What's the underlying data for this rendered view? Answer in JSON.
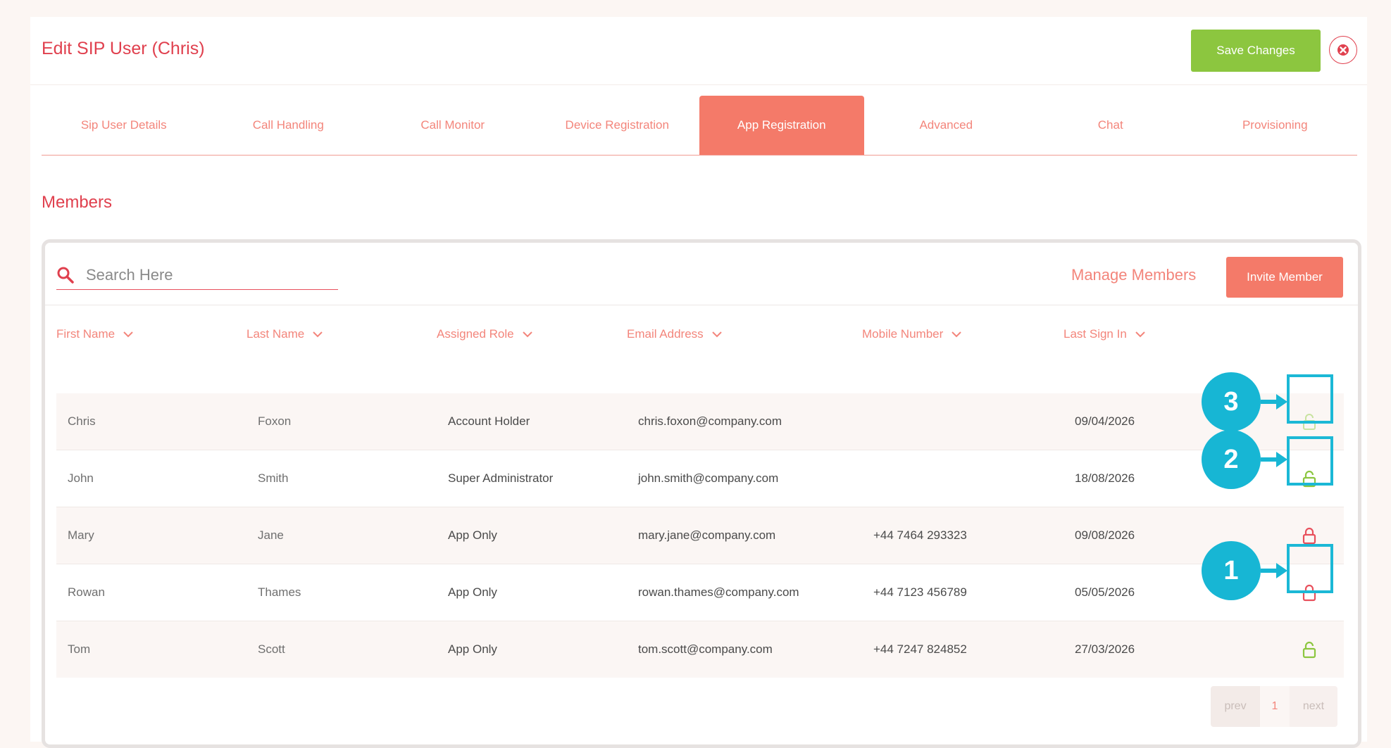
{
  "header": {
    "title": "Edit SIP User (Chris)",
    "save_label": "Save Changes"
  },
  "tabs": [
    {
      "label": "Sip User Details",
      "active": false
    },
    {
      "label": "Call Handling",
      "active": false
    },
    {
      "label": "Call Monitor",
      "active": false
    },
    {
      "label": "Device Registration",
      "active": false
    },
    {
      "label": "App Registration",
      "active": true
    },
    {
      "label": "Advanced",
      "active": false
    },
    {
      "label": "Chat",
      "active": false
    },
    {
      "label": "Provisioning",
      "active": false
    }
  ],
  "members": {
    "section_title": "Members",
    "search_placeholder": "Search Here",
    "manage_label": "Manage Members",
    "invite_label": "Invite Member",
    "columns": [
      "First Name",
      "Last Name",
      "Assigned Role",
      "Email Address",
      "Mobile Number",
      "Last Sign In"
    ],
    "rows": [
      {
        "first": "Chris",
        "last": "Foxon",
        "role": "Account Holder",
        "email": "chris.foxon@company.com",
        "mobile": "",
        "last_sign_in": "09/04/2026",
        "lock": "unlocked-disabled"
      },
      {
        "first": "John",
        "last": "Smith",
        "role": "Super Administrator",
        "email": "john.smith@company.com",
        "mobile": "",
        "last_sign_in": "18/08/2026",
        "lock": "unlocked"
      },
      {
        "first": "Mary",
        "last": "Jane",
        "role": "App Only",
        "email": "mary.jane@company.com",
        "mobile": "+44 7464 293323",
        "last_sign_in": "09/08/2026",
        "lock": "locked"
      },
      {
        "first": "Rowan",
        "last": "Thames",
        "role": "App Only",
        "email": "rowan.thames@company.com",
        "mobile": "+44 7123 456789",
        "last_sign_in": "05/05/2026",
        "lock": "locked"
      },
      {
        "first": "Tom",
        "last": "Scott",
        "role": "App Only",
        "email": "tom.scott@company.com",
        "mobile": "+44 7247 824852",
        "last_sign_in": "27/03/2026",
        "lock": "unlocked"
      }
    ]
  },
  "pagination": {
    "prev": "prev",
    "page": "1",
    "next": "next"
  },
  "callouts": [
    "3",
    "2",
    "1"
  ],
  "colors": {
    "accent": "#e0404e",
    "tab_active": "#f47a69",
    "save_green": "#8cc63f",
    "lock_green": "#8cc63f",
    "lock_red": "#e8505c",
    "callout_cyan": "#17b6d4"
  }
}
